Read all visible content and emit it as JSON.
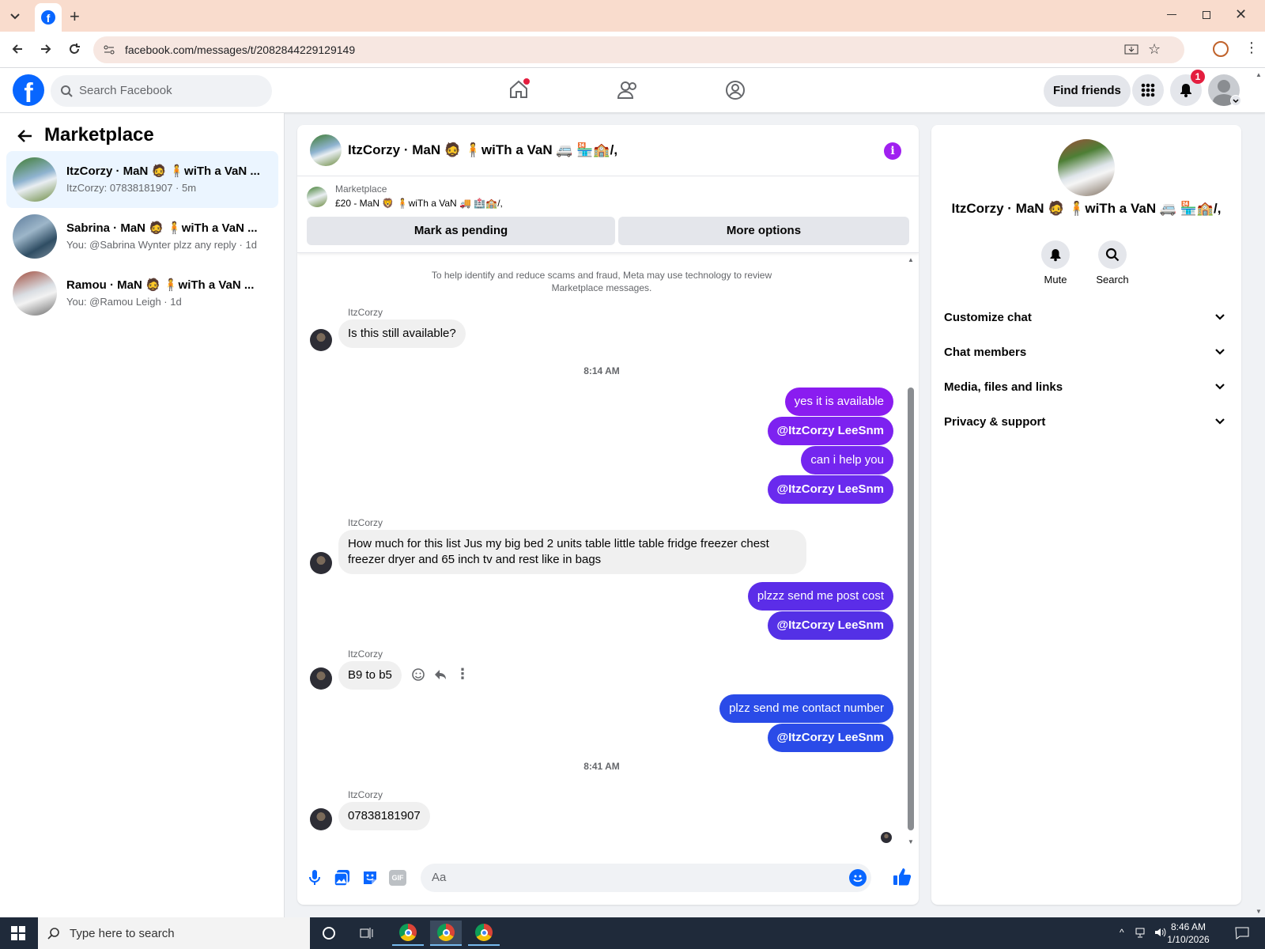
{
  "browser": {
    "url": "facebook.com/messages/t/2082844229129149",
    "new_tab": "+"
  },
  "fb_header": {
    "search_placeholder": "Search Facebook",
    "find_friends": "Find friends",
    "notification_count": "1"
  },
  "left_panel": {
    "title": "Marketplace",
    "conversations": [
      {
        "name": "ItzCorzy · MaN 🧔 🧍wiTh a VaN ...",
        "preview": "ItzCorzy: 07838181907 · 5m",
        "active": true
      },
      {
        "name": "Sabrina · MaN 🧔 🧍wiTh a VaN ...",
        "preview": "You: @Sabrina Wynter plzz any reply · 1d",
        "active": false
      },
      {
        "name": "Ramou · MaN 🧔 🧍wiTh a VaN ...",
        "preview": "You: @Ramou Leigh · 1d",
        "active": false
      }
    ]
  },
  "chat": {
    "header_name": "ItzCorzy · MaN 🧔 🧍wiTh a VaN 🚐 🏪🏫/,",
    "listing_label": "Marketplace",
    "listing_title": "£20 - MaN 🦁 🧍wiTh a VaN 🚚 🏥🏫/,",
    "mark_pending": "Mark as pending",
    "more_options": "More options",
    "notice": "To help identify and reduce scams and fraud, Meta may use technology to review Marketplace messages.",
    "sender": "ItzCorzy",
    "messages": {
      "m1": "Is this still available?",
      "t1": "8:14 AM",
      "o1": "yes it is available",
      "o2": "@ItzCorzy LeeSnm",
      "o3": "can i help you",
      "o4": "@ItzCorzy LeeSnm",
      "m2": "How much for this list Jus my big bed 2 units table little table fridge freezer chest freezer dryer and 65 inch tv and rest like in bags",
      "o5": "plzzz send me post cost",
      "o6": "@ItzCorzy LeeSnm",
      "m3": "B9 to b5",
      "o7": "plzz send me contact number",
      "o8": "@ItzCorzy LeeSnm",
      "t2": "8:41 AM",
      "m4": "07838181907"
    },
    "composer_placeholder": "Aa",
    "gif_label": "GIF"
  },
  "right_panel": {
    "name": "ItzCorzy · MaN 🧔 🧍wiTh a VaN 🚐 🏪🏫/,",
    "mute": "Mute",
    "search": "Search",
    "sections": [
      "Customize chat",
      "Chat members",
      "Media, files and links",
      "Privacy & support"
    ]
  },
  "taskbar": {
    "search_placeholder": "Type here to search",
    "time": "8:46 AM",
    "date": "1/10/2026"
  },
  "colors": {
    "fb_blue": "#0866ff",
    "purple_bubble": "#8a1cf0",
    "violet_bubble": "#5b2de8",
    "blue_bubble": "#2a4be8"
  }
}
